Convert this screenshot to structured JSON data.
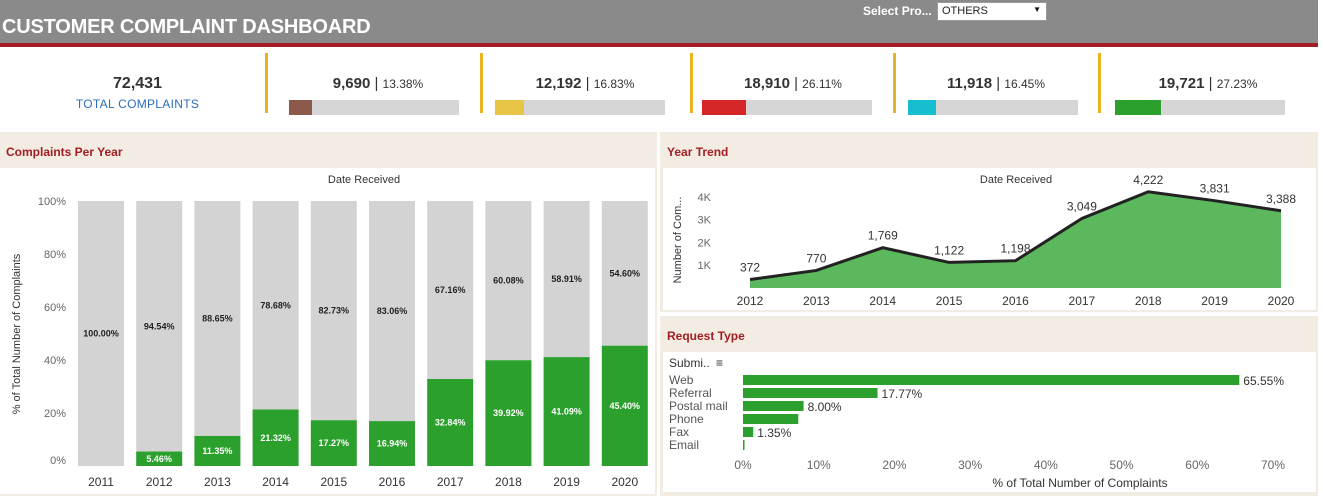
{
  "header": {
    "title": "CUSTOMER COMPLAINT DASHBOARD",
    "select_label": "Select Pro...",
    "select_value": "OTHERS",
    "accent_color": "#a31e22"
  },
  "kpis": {
    "total": {
      "value": "72,431",
      "label": "TOTAL COMPLAINTS"
    },
    "cards": [
      {
        "value": "9,690",
        "pct": "13.38%",
        "fraction": 0.1338,
        "color": "#8b5a4a"
      },
      {
        "value": "12,192",
        "pct": "16.83%",
        "fraction": 0.1683,
        "color": "#e8c547"
      },
      {
        "value": "18,910",
        "pct": "26.11%",
        "fraction": 0.2611,
        "color": "#d62728"
      },
      {
        "value": "11,918",
        "pct": "16.45%",
        "fraction": 0.1645,
        "color": "#17becf"
      },
      {
        "value": "19,721",
        "pct": "27.23%",
        "fraction": 0.2723,
        "color": "#2ca02c"
      }
    ]
  },
  "panels": {
    "per_year": {
      "title": "Complaints Per Year",
      "header": "Date Received"
    },
    "trend": {
      "title": "Year Trend",
      "header": "Date Received"
    },
    "request": {
      "title": "Request Type",
      "header": "Submi..",
      "sort_icon": "sort-icon"
    }
  },
  "chart_data": [
    {
      "type": "bar",
      "title": "Complaints Per Year",
      "xlabel": "Date Received",
      "ylabel": "% of Total Number of Complaints",
      "categories": [
        "2011",
        "2012",
        "2013",
        "2014",
        "2015",
        "2016",
        "2017",
        "2018",
        "2019",
        "2020"
      ],
      "series": [
        {
          "values": [
            0.0,
            5.46,
            11.35,
            21.32,
            17.27,
            16.94,
            32.84,
            39.92,
            41.09,
            45.4
          ],
          "color": "#2ca02c"
        },
        {
          "values": [
            100.0,
            94.54,
            88.65,
            78.68,
            82.73,
            83.06,
            67.16,
            60.08,
            58.91,
            54.6
          ],
          "color": "#d3d3d3"
        }
      ],
      "labels_green": [
        "",
        "5.46%",
        "11.35%",
        "21.32%",
        "17.27%",
        "16.94%",
        "32.84%",
        "39.92%",
        "41.09%",
        "45.40%"
      ],
      "labels_gray": [
        "100.00%",
        "94.54%",
        "88.65%",
        "78.68%",
        "82.73%",
        "83.06%",
        "67.16%",
        "60.08%",
        "58.91%",
        "54.60%"
      ],
      "yticks": [
        "0%",
        "20%",
        "40%",
        "60%",
        "80%",
        "100%"
      ],
      "ylim": [
        0,
        100
      ],
      "stacked": true
    },
    {
      "type": "area",
      "title": "Year Trend",
      "xlabel": "Date Received",
      "ylabel": "Number of Com...",
      "x": [
        "2012",
        "2013",
        "2014",
        "2015",
        "2016",
        "2017",
        "2018",
        "2019",
        "2020"
      ],
      "values": [
        372,
        770,
        1769,
        1122,
        1198,
        3049,
        4222,
        3831,
        3388
      ],
      "labels": [
        "372",
        "770",
        "1,769",
        "1,122",
        "1,198",
        "3,049",
        "4,222",
        "3,831",
        "3,388"
      ],
      "yticks": [
        "1K",
        "2K",
        "3K",
        "4K"
      ],
      "ylim": [
        0,
        4300
      ],
      "color": "#2ca02c"
    },
    {
      "type": "bar",
      "orientation": "horizontal",
      "title": "Request Type",
      "xlabel": "% of Total Number of Complaints",
      "ylabel": "Submi..",
      "categories": [
        "Web",
        "Referral",
        "Postal mail",
        "Phone",
        "Fax",
        "Email"
      ],
      "values": [
        65.55,
        17.77,
        8.0,
        7.3,
        1.35,
        0.2
      ],
      "labels": [
        "65.55%",
        "17.77%",
        "8.00%",
        "",
        "1.35%",
        ""
      ],
      "xticks": [
        "0%",
        "10%",
        "20%",
        "30%",
        "40%",
        "50%",
        "60%",
        "70%"
      ],
      "xlim": [
        0,
        70
      ],
      "color": "#2ca02c"
    }
  ]
}
